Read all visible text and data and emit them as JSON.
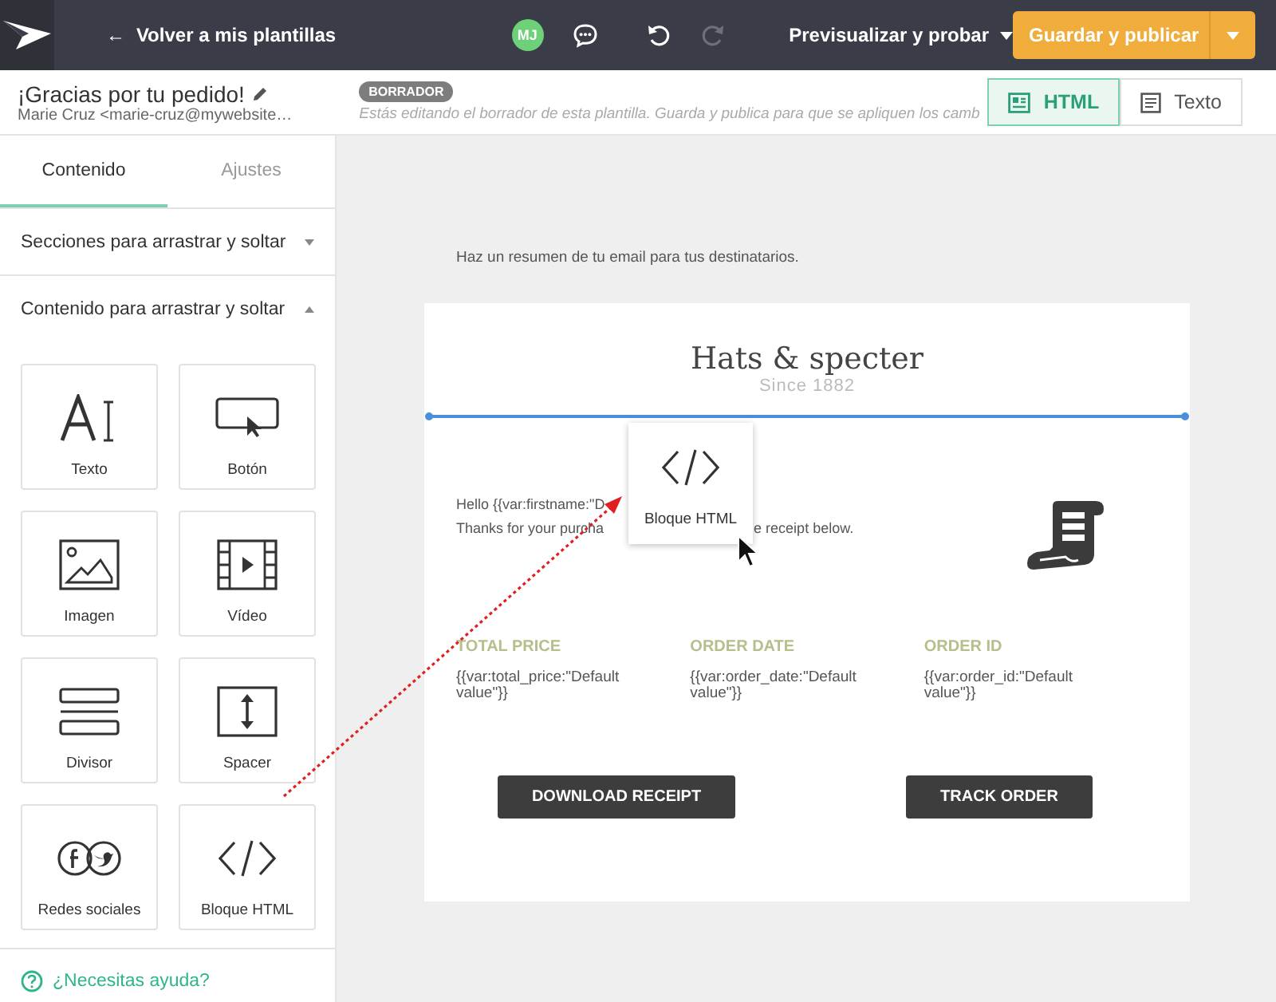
{
  "topbar": {
    "back_arrow": "←",
    "back_link": "Volver a mis plantillas",
    "avatar_initials": "MJ",
    "preview_menu": "Previsualizar y probar",
    "publish_button": "Guardar y publicar"
  },
  "header": {
    "template_title": "¡Gracias por tu pedido!",
    "sender": "Marie Cruz <marie-cruz@mywebsite…",
    "status_badge": "BORRADOR",
    "notice": "Estás editando el borrador de esta plantilla. Guarda y publica para que se apliquen los camb",
    "view_tabs": [
      {
        "label": "HTML",
        "kind": "html",
        "selected": true
      },
      {
        "label": "Texto",
        "kind": "text",
        "selected": false
      }
    ]
  },
  "sidebar": {
    "tabs": [
      {
        "label": "Contenido",
        "selected": true
      },
      {
        "label": "Ajustes",
        "selected": false
      }
    ],
    "sections": [
      {
        "title": "Secciones para arrastrar y soltar",
        "expanded": false
      },
      {
        "title": "Contenido para arrastrar y soltar",
        "expanded": true,
        "blocks": [
          {
            "label": "Texto",
            "kind": "text"
          },
          {
            "label": "Botón",
            "kind": "button"
          },
          {
            "label": "Imagen",
            "kind": "image"
          },
          {
            "label": "Vídeo",
            "kind": "video"
          },
          {
            "label": "Divisor",
            "kind": "divider"
          },
          {
            "label": "Spacer",
            "kind": "spacer"
          },
          {
            "label": "Redes sociales",
            "kind": "social"
          },
          {
            "label": "Bloque HTML",
            "kind": "html"
          }
        ]
      }
    ],
    "help_link": "¿Necesitas ayuda?"
  },
  "canvas": {
    "preheader": "Haz un resumen de tu email para tus destinatarios.",
    "email": {
      "brand": "Hats & specter",
      "since": "Since 1882",
      "greeting": "Hello {{var:firstname:\"D",
      "thanks_start": "Thanks for your purcha",
      "thanks_end": "e receipt below.",
      "fields": [
        {
          "label": "TOTAL PRICE",
          "value": "{{var:total_price:\"Default value\"}}"
        },
        {
          "label": "ORDER DATE",
          "value": "{{var:order_date:\"Default value\"}}"
        },
        {
          "label": "ORDER ID",
          "value": "{{var:order_id:\"Default value\"}}"
        }
      ],
      "buttons": [
        "DOWNLOAD RECEIPT",
        "TRACK ORDER"
      ]
    },
    "dragged_block": {
      "label": "Bloque HTML",
      "kind": "html"
    }
  }
}
